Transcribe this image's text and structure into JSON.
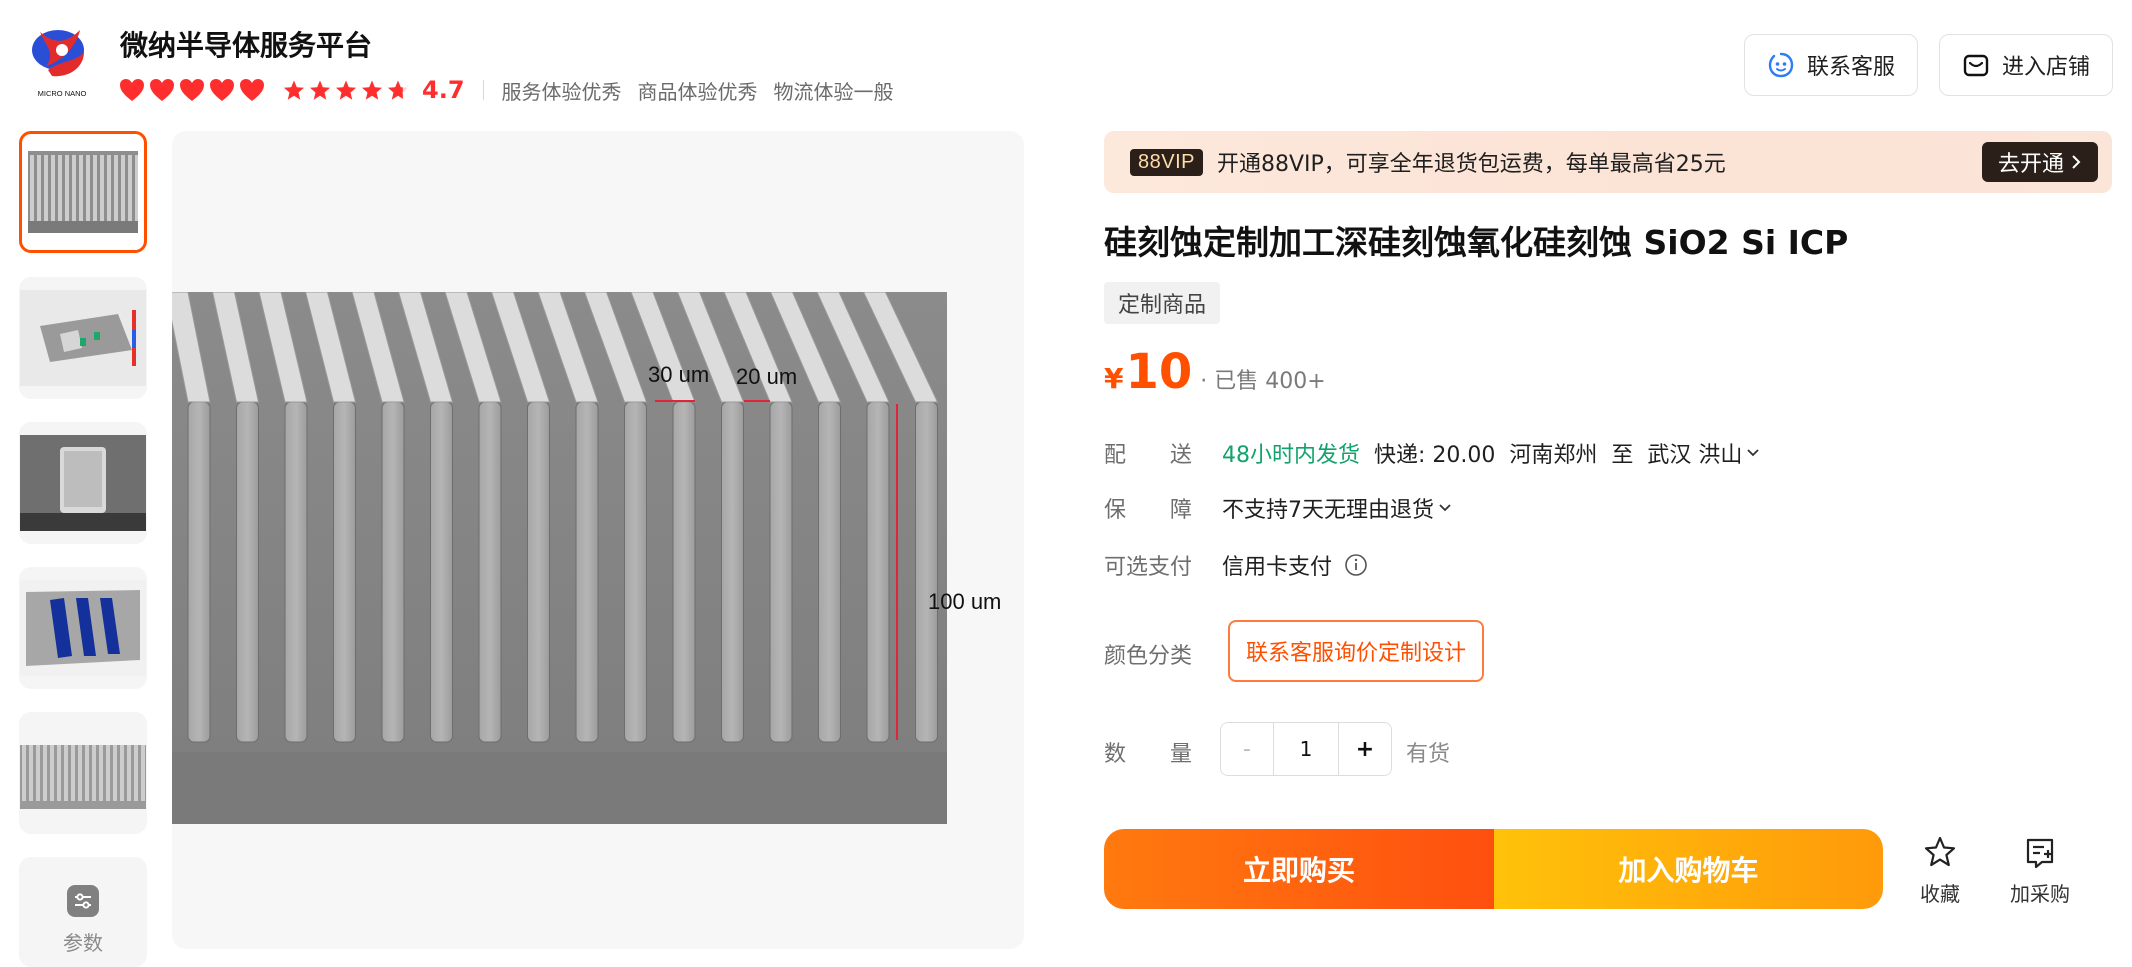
{
  "header": {
    "logo_text": "MICRO NANO",
    "shop_name": "微纳半导体服务平台",
    "hearts": 5,
    "stars": 4.7,
    "score": "4.7",
    "service_tags": [
      "服务体验优秀",
      "商品体验优秀",
      "物流体验一般"
    ],
    "contact_label": "联系客服",
    "store_label": "进入店铺"
  },
  "gallery": {
    "thumbnails": [
      "thumb-1",
      "thumb-2",
      "thumb-3",
      "thumb-4",
      "thumb-5"
    ],
    "active_index": 0,
    "params_label": "参数",
    "main_image_annotations": {
      "width_1": "30 um",
      "width_2": "20 um",
      "depth": "100 um"
    }
  },
  "vip": {
    "badge": "88VIP",
    "text": "开通88VIP，可享全年退货包运费，每单最高省25元",
    "cta": "去开通"
  },
  "product": {
    "title": "硅刻蚀定制加工深硅刻蚀氧化硅刻蚀 SiO2 Si ICP",
    "tag": "定制商品",
    "currency": "¥",
    "price": "10",
    "sold": "· 已售 400+"
  },
  "delivery": {
    "label": "配　　送",
    "speed": "48小时内发货",
    "fee": "快递: 20.00",
    "from": "河南郑州",
    "to_word": "至",
    "destination": "武汉 洪山"
  },
  "guarantee": {
    "label": "保　　障",
    "value": "不支持7天无理由退货"
  },
  "payment": {
    "label": "可选支付",
    "value": "信用卡支付"
  },
  "sku": {
    "label": "颜色分类",
    "option": "联系客服询价定制设计"
  },
  "quantity": {
    "label": "数　　量",
    "minus": "-",
    "value": "1",
    "plus": "+",
    "stock": "有货"
  },
  "actions": {
    "buy": "立即购买",
    "cart": "加入购物车",
    "favorite": "收藏",
    "purchase_list": "加采购"
  },
  "colors": {
    "accent": "#ff5000",
    "green": "#11a36b",
    "heart": "#ff2e2e"
  }
}
